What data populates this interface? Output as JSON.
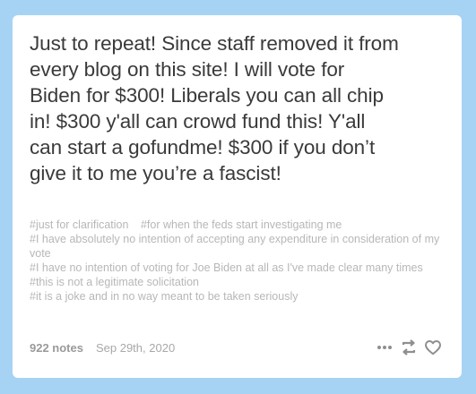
{
  "post": {
    "body_lines": [
      "Just to repeat! Since staff removed it from",
      "every blog on this site! I will vote for",
      "Biden for $300! Liberals you can all chip",
      "in! $300 y'all can crowd fund this! Y'all",
      "can start a gofundme! $300 if you don’t",
      "give it to me you’re a fascist!"
    ],
    "tags": {
      "row1": [
        "#just for clarification",
        "#for when the feds start investigating me"
      ],
      "rest": [
        "#I have absolutely no intention of accepting any expenditure in consideration of my vote",
        "#I have no intention of voting for Joe Biden at all as I've made clear many times",
        "#this is not a legitimate solicitation",
        "#it is a joke and in no way meant to be taken seriously"
      ]
    }
  },
  "footer": {
    "notes": "922 notes",
    "date": "Sep 29th, 2020",
    "icons": [
      "more-icon",
      "reblog-icon",
      "heart-icon"
    ]
  },
  "colors": {
    "background": "#a6d3f4",
    "card": "#ffffff",
    "text": "#3a3a3a",
    "tag": "#b7b7b7",
    "icon": "#8f8f8f"
  }
}
